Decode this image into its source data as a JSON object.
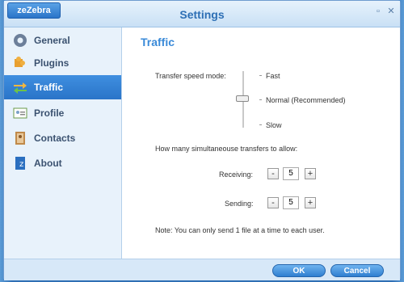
{
  "window": {
    "badge": "zeZebra",
    "title": "Settings"
  },
  "sidebar": {
    "items": [
      {
        "label": "General",
        "icon": "gear-icon"
      },
      {
        "label": "Plugins",
        "icon": "puzzle-icon"
      },
      {
        "label": "Traffic",
        "icon": "transfer-arrows-icon",
        "active": true
      },
      {
        "label": "Profile",
        "icon": "id-card-icon"
      },
      {
        "label": "Contacts",
        "icon": "address-book-icon"
      },
      {
        "label": "About",
        "icon": "info-book-icon"
      }
    ]
  },
  "traffic": {
    "heading": "Traffic",
    "speed_mode_label": "Transfer speed mode:",
    "speed_options": [
      "Fast",
      "Normal (Recommended)",
      "Slow"
    ],
    "selected_speed": "Normal (Recommended)",
    "transfers_label": "How many simultaneouse transfers to allow:",
    "receiving_label": "Receiving:",
    "receiving_value": "5",
    "sending_label": "Sending:",
    "sending_value": "5",
    "minus": "-",
    "plus": "+",
    "note": "Note: You can only send 1 file at a time to each user."
  },
  "footer": {
    "ok": "OK",
    "cancel": "Cancel"
  },
  "colors": {
    "accent": "#2a74c8",
    "heading": "#3a8ad8"
  }
}
